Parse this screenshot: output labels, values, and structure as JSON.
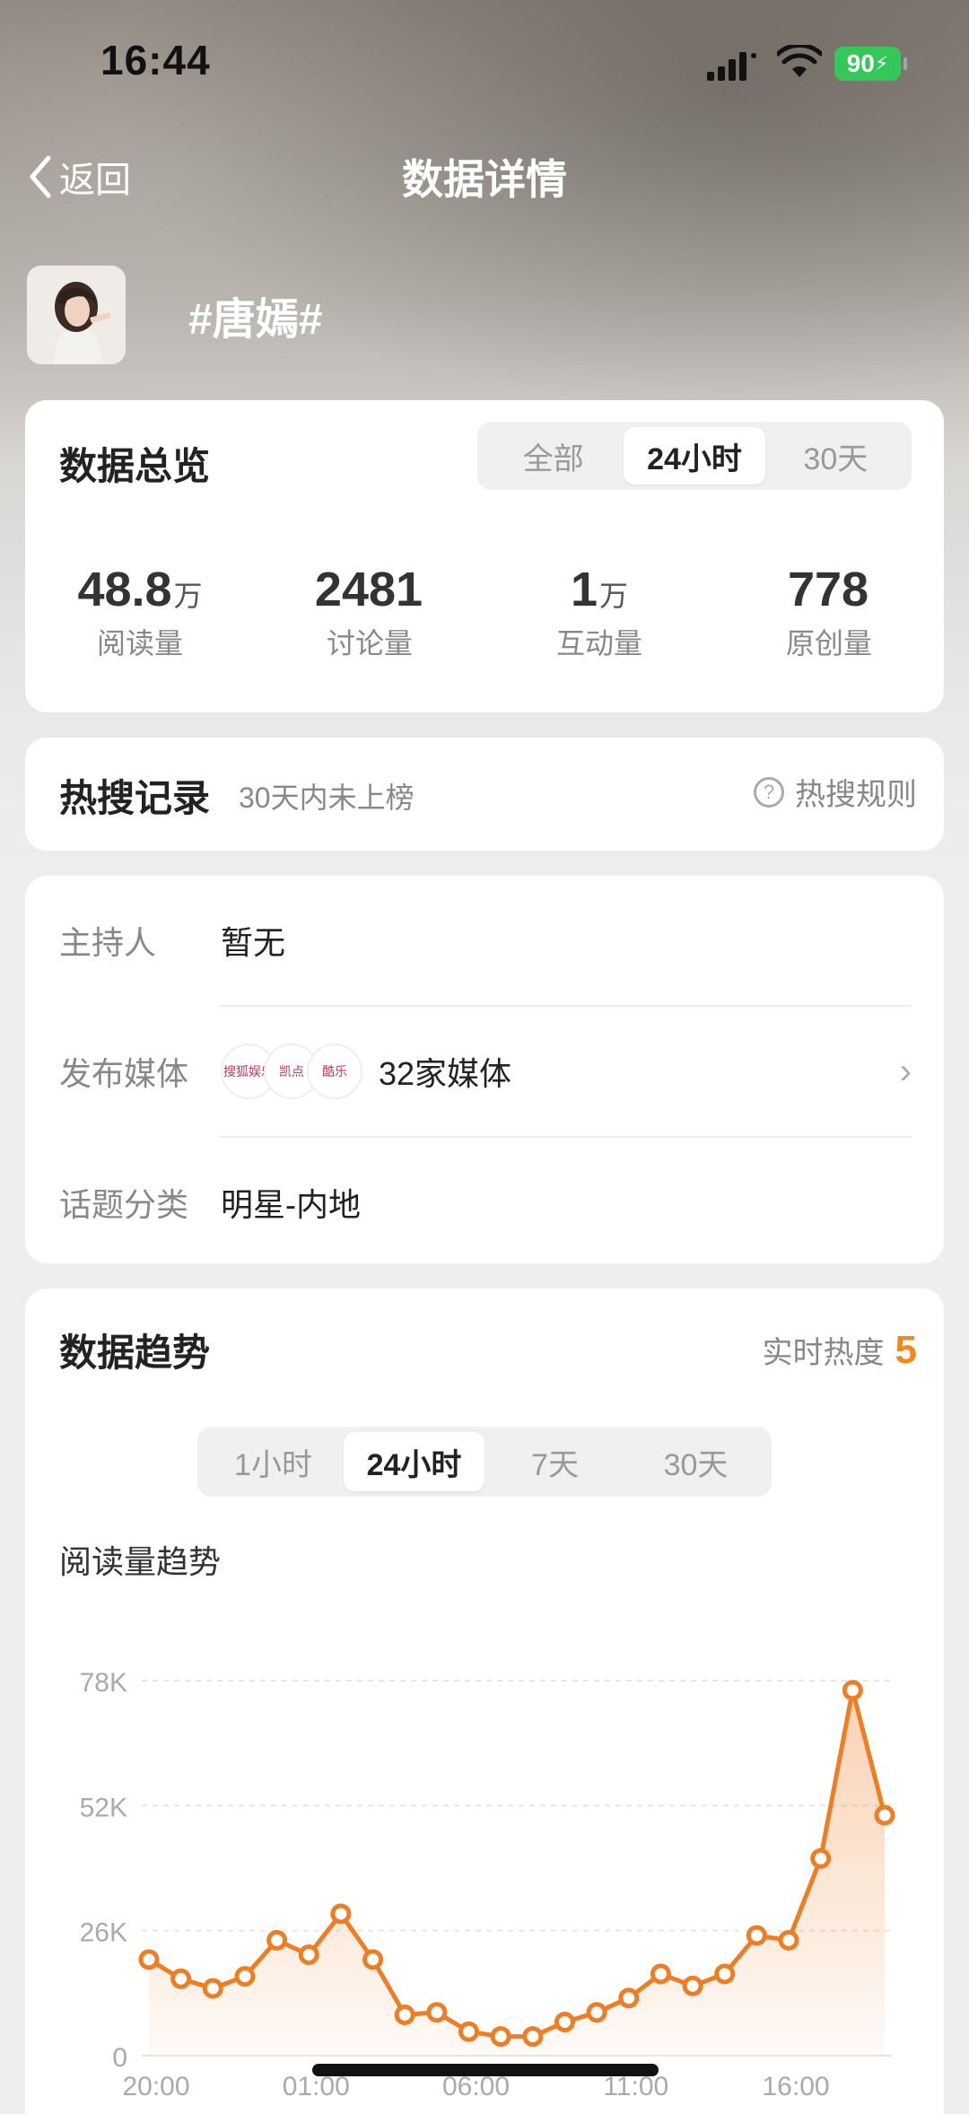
{
  "status": {
    "time": "16:44",
    "battery": "90"
  },
  "nav": {
    "back_label": "返回",
    "title": "数据详情"
  },
  "topic": {
    "title": "#唐嫣#"
  },
  "overview": {
    "title": "数据总览",
    "tabs": [
      "全部",
      "24小时",
      "30天"
    ],
    "active_tab": "24小时",
    "stats": [
      {
        "value": "48.8",
        "unit": "万",
        "label": "阅读量"
      },
      {
        "value": "2481",
        "unit": "",
        "label": "讨论量"
      },
      {
        "value": "1",
        "unit": "万",
        "label": "互动量"
      },
      {
        "value": "778",
        "unit": "",
        "label": "原创量"
      }
    ]
  },
  "hot_search": {
    "title": "热搜记录",
    "subtitle": "30天内未上榜",
    "rule_label": "热搜规则"
  },
  "info": {
    "host_key": "主持人",
    "host_value": "暂无",
    "media_key": "发布媒体",
    "media_value": "32家媒体",
    "media_logos": [
      "搜狐娱乐",
      "凯点",
      "酷乐"
    ],
    "category_key": "话题分类",
    "category_value": "明星-内地"
  },
  "trend": {
    "title": "数据趋势",
    "heat_label": "实时热度",
    "heat_value": "5",
    "tabs": [
      "1小时",
      "24小时",
      "7天",
      "30天"
    ],
    "active_tab": "24小时",
    "chart_title": "阅读量趋势"
  },
  "chart_data": {
    "type": "area",
    "title": "阅读量趋势",
    "y_ticks": [
      "78K",
      "52K",
      "26K",
      "0"
    ],
    "ylim": [
      0,
      78000
    ],
    "x_ticks": [
      "20:00",
      "01:00",
      "06:00",
      "11:00",
      "16:00"
    ],
    "values": [
      20000,
      16000,
      14000,
      16500,
      24000,
      21000,
      29500,
      20000,
      8500,
      9000,
      5000,
      4000,
      4000,
      7000,
      9000,
      12000,
      17000,
      14500,
      17000,
      25000,
      24000,
      41000,
      76000,
      50000
    ],
    "color": "#ee7d24",
    "grid": true
  }
}
